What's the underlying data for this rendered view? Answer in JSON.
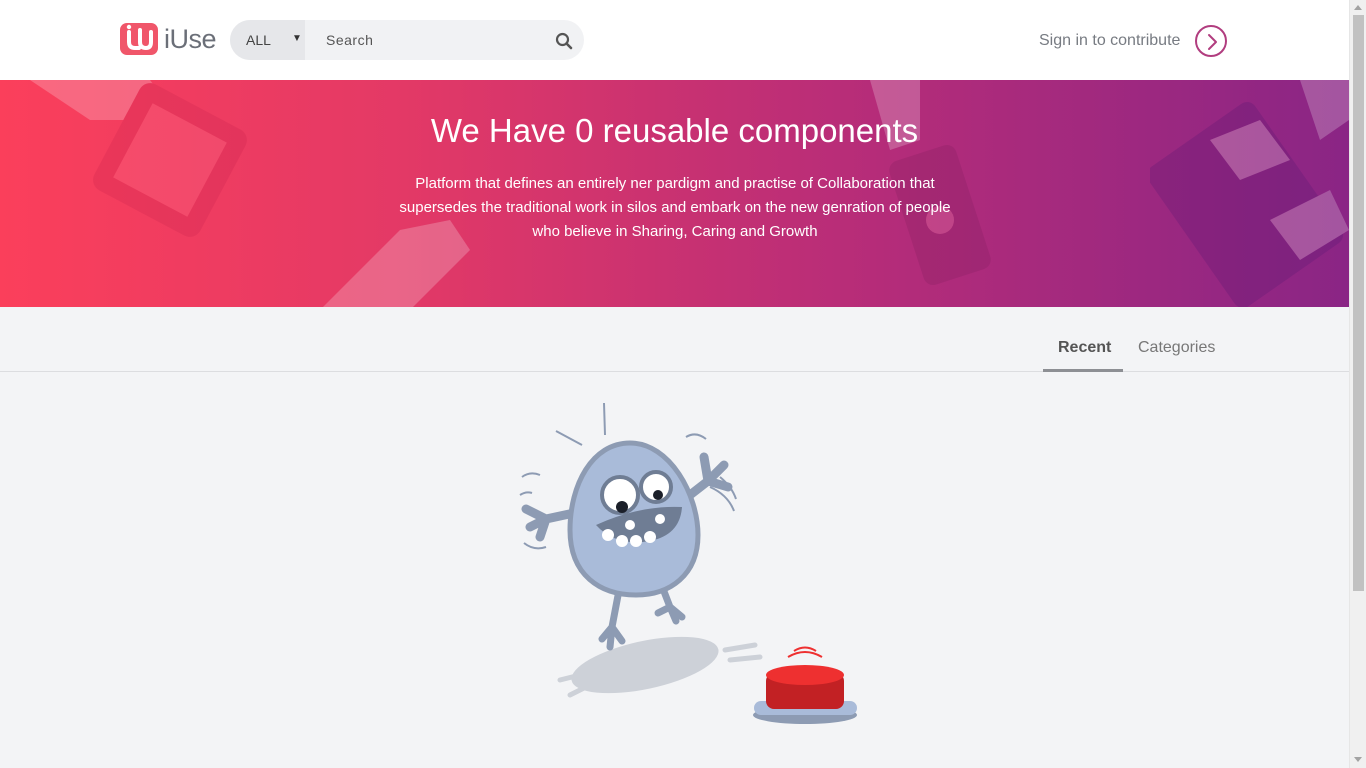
{
  "header": {
    "logo_text": "iUse",
    "search": {
      "category_selected": "ALL",
      "placeholder": "Search"
    },
    "signin_label": "Sign in to contribute"
  },
  "hero": {
    "title": "We Have 0 reusable components",
    "description": "Platform that defines an entirely ner pardigm and practise of Collaboration that supersedes the traditional work in silos and embark on the new genration of people who believe in Sharing, Caring and Growth"
  },
  "tabs": [
    {
      "label": "Recent",
      "active": true
    },
    {
      "label": "Categories",
      "active": false
    }
  ],
  "icons": {
    "logo": "logo-icon",
    "search": "search-icon",
    "signin_arrow": "chevron-right-icon"
  },
  "colors": {
    "brand": "#f0566a",
    "accent": "#b13d7f",
    "hero_gradient_start": "#fb3f5b",
    "hero_gradient_end": "#8a2585"
  }
}
